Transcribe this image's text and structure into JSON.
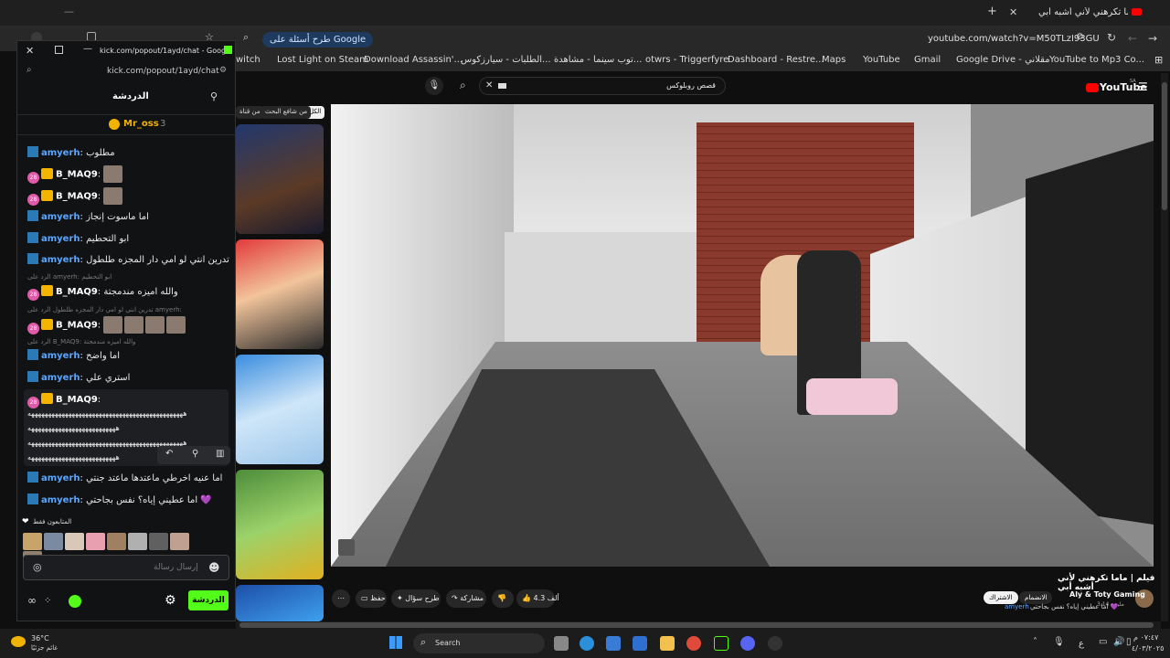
{
  "browser": {
    "tab_title": "فيلم | ماما تكرهني لأني أشبه أبي",
    "url": "youtube.com/watch?v=M50TLzI93GU",
    "google_pill": "طرح أسئلة على Google",
    "bookmarks": [
      "YouTube to Mp3 Co...",
      "Google Drive - مقلاني",
      "Gmail",
      "YouTube",
      "Maps",
      "Dashboard - Restre...",
      "otwrs - Triggerfyre",
      "توب سينما - مشاهدة...",
      "الطلبات - سيارزكوس...",
      "Download Assassin'...",
      "Lost Light on Steam",
      "witch"
    ]
  },
  "youtube": {
    "logo": "YouTube",
    "logo_country": "SA",
    "search_value": "قصص روبلوكس",
    "chips": [
      "الكل",
      "من شافع البحث",
      "من قناة"
    ],
    "video_title": "فيلم | ماما تكرهني لأني أشبه أبي",
    "channel": "Aly & Toty Gaming",
    "subscribers": "3.14 مليون",
    "subscribe_label": "الاشتراك",
    "join_label": "الانضمام",
    "likes": "4.3 ألف",
    "share_label": "مشاركة",
    "ask_label": "طرح سؤال",
    "save_label": "حفظ",
    "overlay_comment_user": "amyerh",
    "overlay_comment_text": "اما عطيني إياه؟ نفس بجاحتي 💜"
  },
  "kick": {
    "window_title": "kick.com/popout/1ayd/chat - Goog...",
    "url": "kick.com/popout/1ayd/chat",
    "header": "الدردشة",
    "pinned_user": "Mr_oss",
    "pinned_count": "3",
    "messages": [
      {
        "user": "amyerh",
        "text": "مطلوب"
      },
      {
        "user": "B_MAQ9",
        "text": "",
        "level": "28"
      },
      {
        "user": "B_MAQ9",
        "text": "",
        "level": "28"
      },
      {
        "user": "amyerh",
        "text": "اما ماسوت إنجاز"
      },
      {
        "user": "amyerh",
        "text": "ابو التحطيم"
      },
      {
        "user": "amyerh",
        "text": "تدرين انتي لو امي دار المجزه طلطول"
      },
      {
        "user": "B_MAQ9",
        "text": "والله اميزه مندمجتة",
        "level": "28",
        "reply": "الرد على amyerh: ابو التحطيم"
      },
      {
        "user": "B_MAQ9",
        "text": "",
        "level": "28",
        "reply": "تدرين انتي لو امي دار المجزه طلطول الرد على amyerh:"
      },
      {
        "user": "amyerh",
        "text": "اما واضح",
        "reply": "الرد على B_MAQ9: والله اميزه مندمجتة"
      },
      {
        "user": "amyerh",
        "text": "استري علي"
      },
      {
        "user": "B_MAQ9",
        "text": "",
        "level": "28"
      },
      {
        "user": "amyerh",
        "text": "اما عنيه اخرطي ماعتدها ماعتد جنتي"
      },
      {
        "user": "amyerh",
        "text": "اما عطيني إياه؟ نفس بجاحتي 💜"
      }
    ],
    "long_line": "ههههههههههههههههههههههههههههههههههههههههههههههه",
    "long_line_short": "ههههههههههههههههههههههههههه",
    "supporters_label": "المتابعون فقط",
    "input_placeholder": "إرسال رسالة",
    "chat_button": "الدردشة"
  },
  "taskbar": {
    "weather_temp": "36°C",
    "weather_desc": "غائم جزئيًا",
    "search": "Search",
    "time": "٠٧:٤٧ م",
    "date": "٤/٠٣/٢٠٢٥",
    "lang": "ع"
  }
}
